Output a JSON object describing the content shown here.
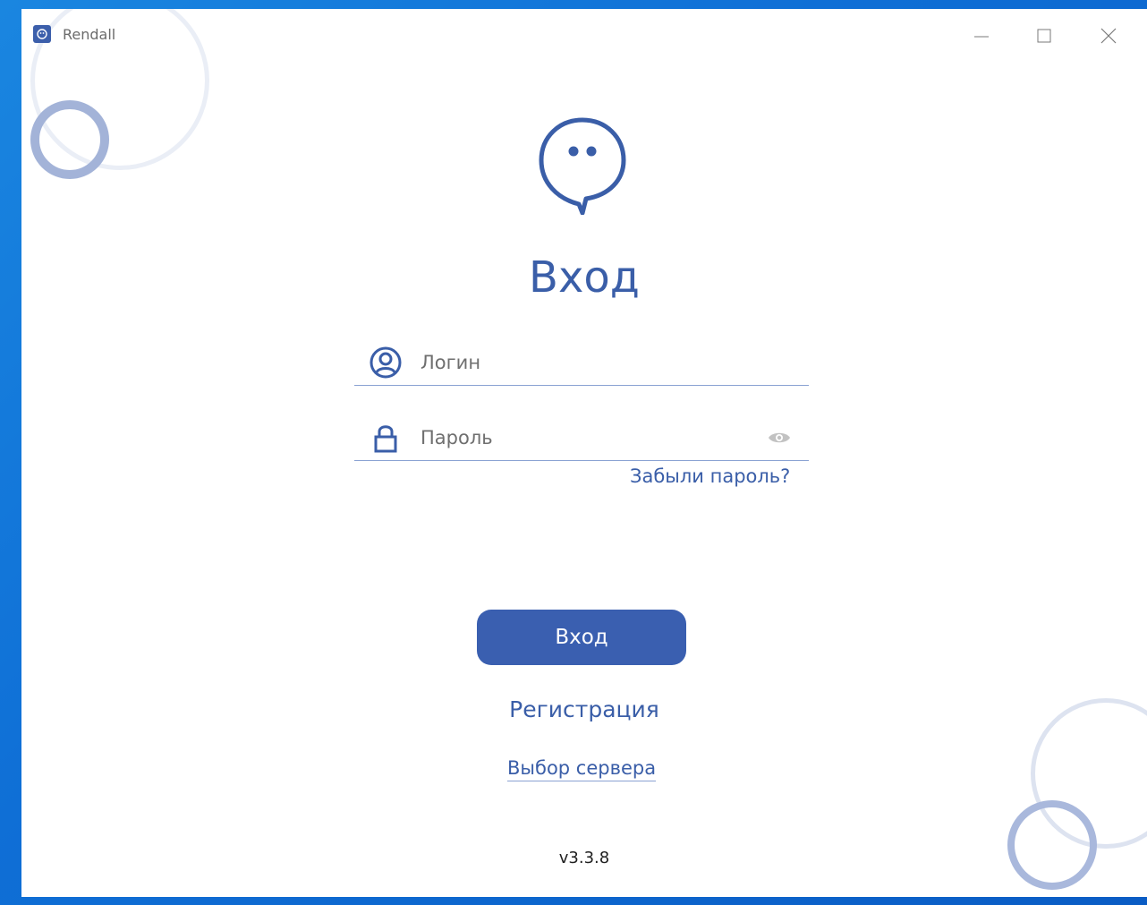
{
  "window": {
    "title": "Rendall",
    "controls": [
      "minimize-icon",
      "maximize-icon",
      "close-icon"
    ]
  },
  "login": {
    "heading": "Вход",
    "login_placeholder": "Логин",
    "password_placeholder": "Пароль",
    "forgot_password": "Забыли пароль?",
    "submit_label": "Вход",
    "register_label": "Регистрация",
    "server_select_label": "Выбор сервера",
    "version": "v3.3.8"
  },
  "colors": {
    "accent": "#3a5fb0",
    "text_accent": "#3a5ea8",
    "background": "#ffffff",
    "desktop": "#0f6fd6"
  }
}
